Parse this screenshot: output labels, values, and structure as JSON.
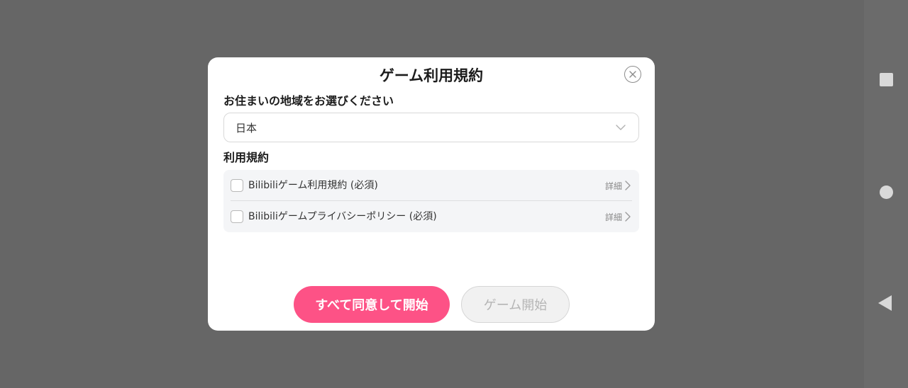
{
  "dialog": {
    "title": "ゲーム利用規約",
    "region_label": "お住まいの地域をお選びください",
    "region_value": "日本",
    "terms_label": "利用規約",
    "terms": [
      {
        "label": "Bilibiliゲーム利用規約 (必須)",
        "detail": "詳細"
      },
      {
        "label": "Bilibiliゲームプライバシーポリシー (必須)",
        "detail": "詳細"
      }
    ],
    "agree_button": "すべて同意して開始",
    "start_button": "ゲーム開始"
  },
  "colors": {
    "accent": "#fd5286",
    "overlay": "#666666",
    "disabled_text": "#b5b5b5"
  },
  "icons": {
    "close": "close-icon",
    "dropdown": "chevron-down-icon",
    "detail": "chevron-right-icon",
    "nav": [
      "recents-icon",
      "home-icon",
      "back-icon"
    ]
  }
}
